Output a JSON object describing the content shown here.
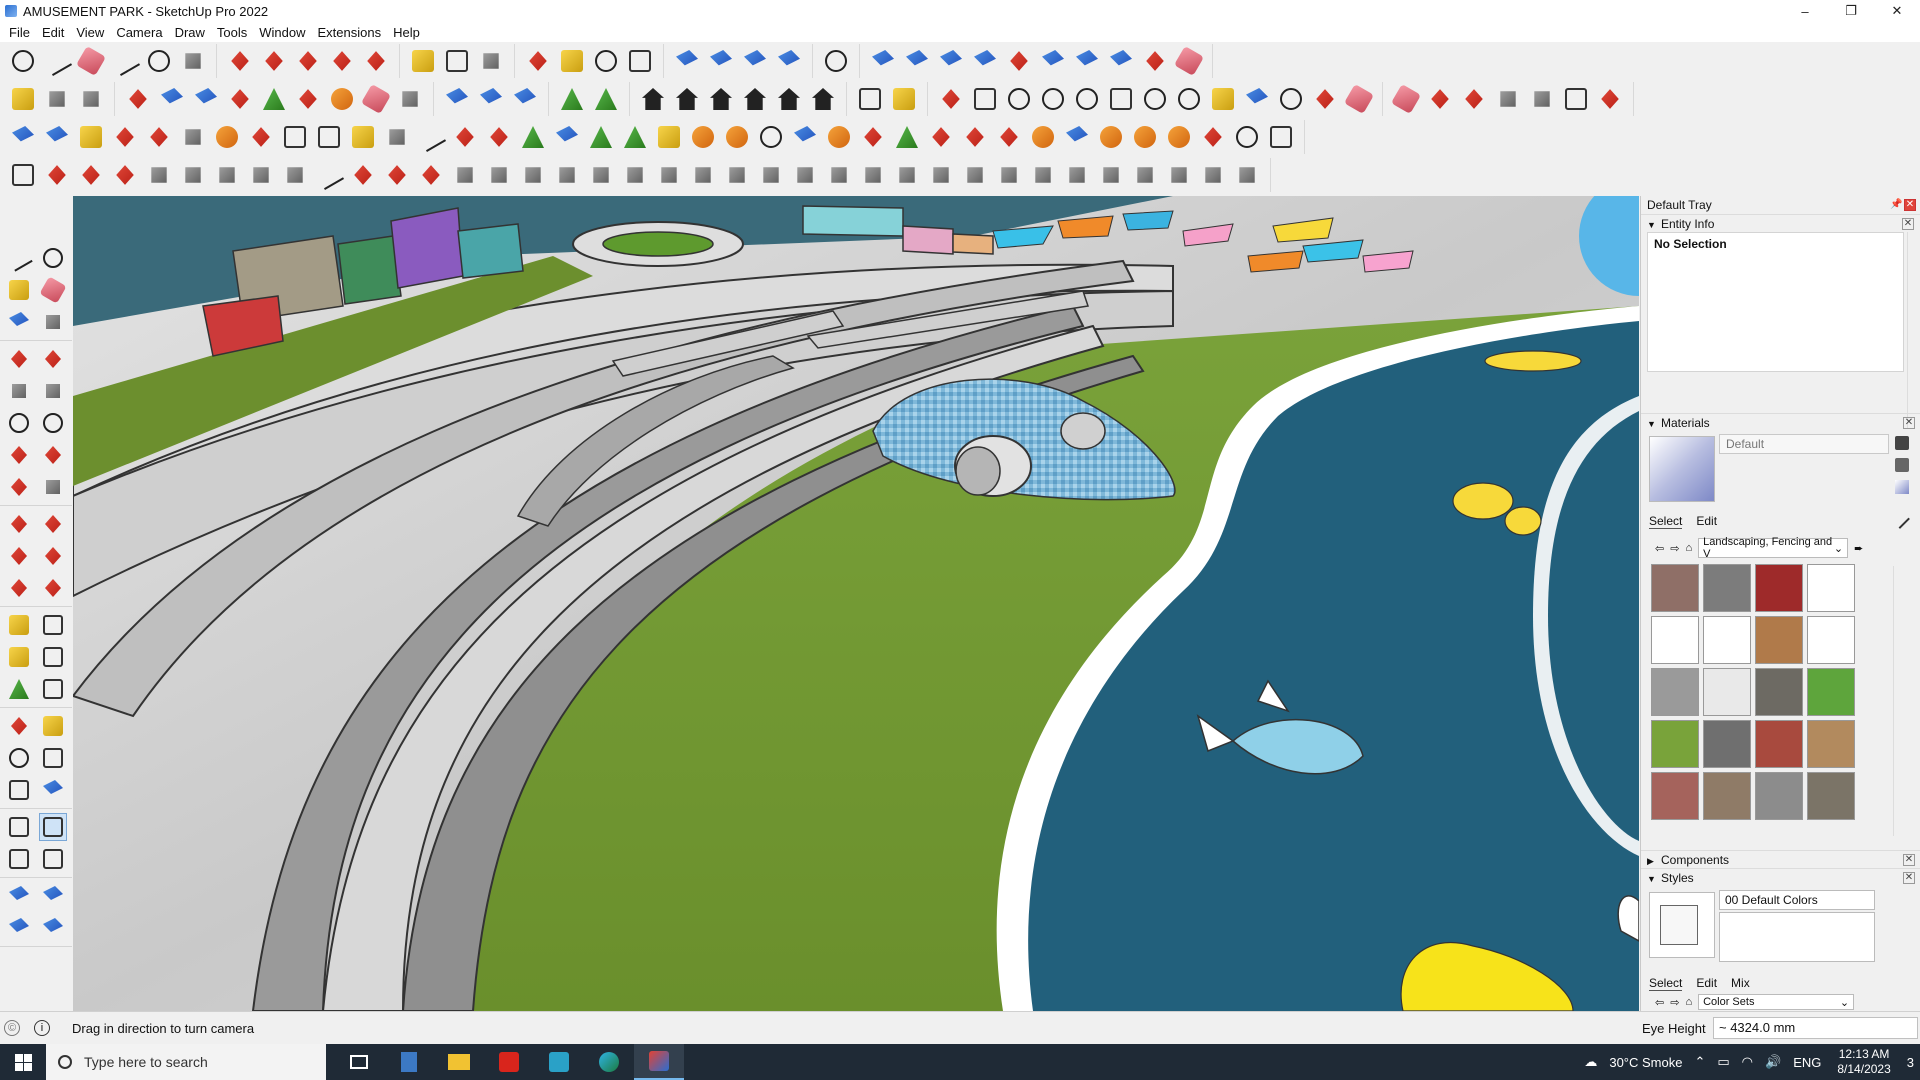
{
  "window": {
    "title": "AMUSEMENT PARK - SketchUp Pro 2022",
    "controls": [
      "–",
      "❐",
      "✕"
    ]
  },
  "menu": [
    "File",
    "Edit",
    "View",
    "Camera",
    "Draw",
    "Tools",
    "Window",
    "Extensions",
    "Help"
  ],
  "tray": {
    "title": "Default Tray",
    "entity_info": {
      "title": "Entity Info",
      "status": "No Selection"
    },
    "materials": {
      "title": "Materials",
      "current": "Default",
      "tabs": [
        "Select",
        "Edit"
      ],
      "library": "Landscaping, Fencing and V",
      "swatch_colors": [
        "#8f6f67",
        "#7c7c7c",
        "#9e2a2a",
        "#ffffff",
        "#ffffff",
        "#ffffff",
        "#b07a4a",
        "#ffffff",
        "#9a9a9a",
        "#e9e9e9",
        "#6d6a63",
        "#5ea53c",
        "#79a33a",
        "#6f6f6f",
        "#a84a3e",
        "#b28a5e",
        "#a5635c",
        "#8f7b67",
        "#8c8c8c",
        "#7b7467"
      ]
    },
    "components": {
      "title": "Components"
    },
    "styles": {
      "title": "Styles",
      "current": "00 Default Colors",
      "tabs": [
        "Select",
        "Edit",
        "Mix"
      ],
      "collection": "Color Sets"
    }
  },
  "status": {
    "message": "Drag in direction to turn camera",
    "measurement_label": "Eye Height",
    "measurement_value": "~ 4324.0 mm"
  },
  "taskbar": {
    "search_placeholder": "Type here to search",
    "weather": "30°C  Smoke",
    "language": "ENG",
    "time": "12:13 AM",
    "date": "8/14/2023",
    "notifications": "3"
  },
  "colors": {
    "grass": "#6f9a33",
    "water": "#22607c",
    "paving": "#cfcfcf",
    "tray_bg": "#f0f0f0",
    "taskbar_bg": "#1f2a36"
  }
}
